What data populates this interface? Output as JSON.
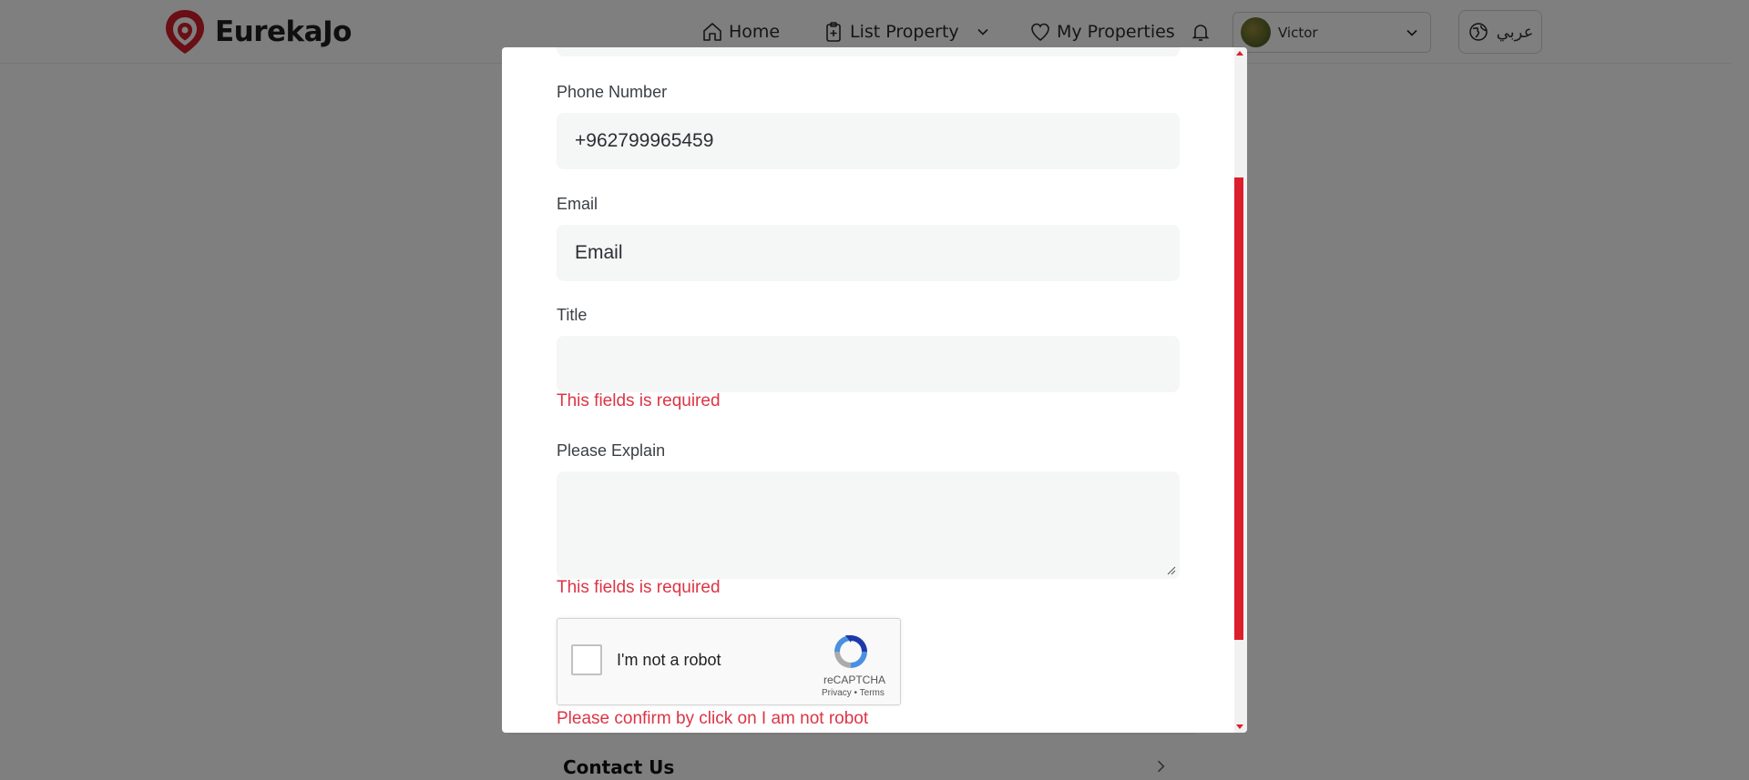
{
  "header": {
    "brand": "EurekaJo",
    "nav": {
      "home": "Home",
      "list_property": "List Property",
      "my_properties": "My Properties"
    },
    "user": {
      "name": "Victor"
    },
    "language_button": "عربي",
    "icons": [
      "logo-icon",
      "home-icon",
      "clipboard-plus-icon",
      "chevron-down-icon",
      "heart-icon",
      "bell-icon",
      "globe-icon"
    ]
  },
  "page": {
    "contact_us": "Contact Us"
  },
  "modal": {
    "phone": {
      "label": "Phone Number",
      "value": "+962799965459"
    },
    "email": {
      "label": "Email",
      "placeholder": "Email",
      "value": ""
    },
    "title": {
      "label": "Title",
      "value": "",
      "error": "This fields is required"
    },
    "explain": {
      "label": "Please Explain",
      "value": "",
      "error": "This fields is required"
    },
    "captcha": {
      "label": "I'm not a robot",
      "brand": "reCAPTCHA",
      "links": "Privacy - Terms",
      "checked": false,
      "error": "Please confirm by click on I am not robot"
    },
    "scroll_position_fraction": 0.24
  },
  "colors": {
    "accent": "#dc1f2c",
    "error": "#dc3545",
    "field_bg": "#f5f6f6",
    "overlay": "rgba(0,0,0,0.5)"
  }
}
